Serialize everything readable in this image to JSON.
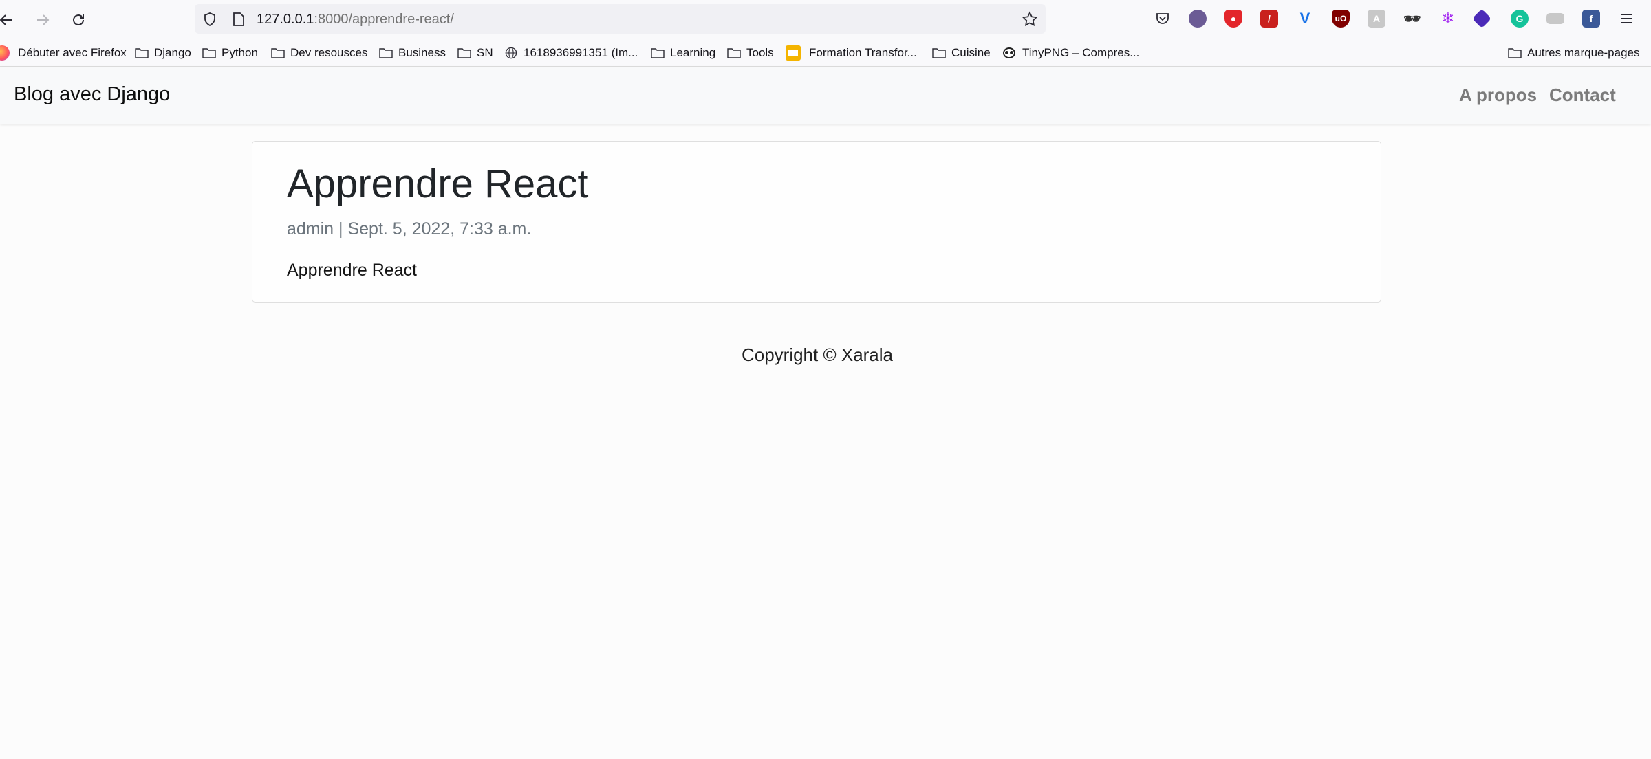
{
  "browser": {
    "url_host": "127.0.0.1",
    "url_rest": ":8000/apprendre-react/",
    "bookmarks": [
      {
        "label": "Débuter avec Firefox",
        "icon": "firefox-icon"
      },
      {
        "label": "Django",
        "icon": "folder-icon"
      },
      {
        "label": "Python",
        "icon": "folder-icon"
      },
      {
        "label": "Dev resousces",
        "icon": "folder-icon"
      },
      {
        "label": "Business",
        "icon": "folder-icon"
      },
      {
        "label": "SN",
        "icon": "folder-icon"
      },
      {
        "label": "1618936991351 (Im...",
        "icon": "globe-icon"
      },
      {
        "label": "Learning",
        "icon": "folder-icon"
      },
      {
        "label": "Tools",
        "icon": "folder-icon"
      },
      {
        "label": "Formation Transfor...",
        "icon": "slides-icon"
      },
      {
        "label": "Cuisine",
        "icon": "folder-icon"
      },
      {
        "label": "TinyPNG – Compres...",
        "icon": "panda-icon"
      }
    ],
    "other_bookmarks": "Autres marque-pages",
    "colors": {
      "toolbar": "#f9f9fb",
      "urlbar": "#f0f0f4"
    }
  },
  "site": {
    "brand": "Blog avec Django",
    "nav": [
      "A propos",
      "Contact"
    ]
  },
  "post": {
    "title": "Apprendre React",
    "meta": "admin | Sept. 5, 2022, 7:33 a.m.",
    "body": "Apprendre React"
  },
  "footer": {
    "copyright": "Copyright © Xarala"
  }
}
